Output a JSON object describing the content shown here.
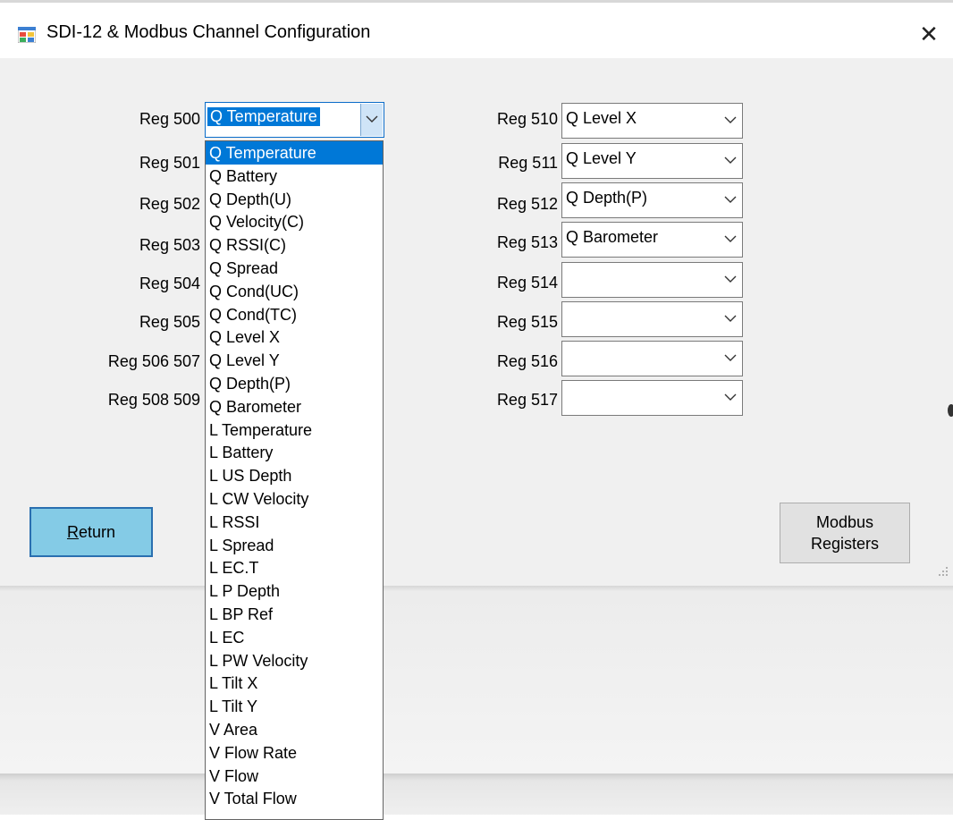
{
  "window": {
    "title": "SDI-12 & Modbus Channel Configuration",
    "close_glyph": "✕"
  },
  "left_registers": [
    {
      "label": "Reg 500",
      "value": "Q  Temperature"
    },
    {
      "label": "Reg 501"
    },
    {
      "label": "Reg 502"
    },
    {
      "label": "Reg 503"
    },
    {
      "label": "Reg 504"
    },
    {
      "label": "Reg 505"
    },
    {
      "label": "Reg 506 507"
    },
    {
      "label": "Reg 508 509"
    }
  ],
  "right_registers": [
    {
      "label": "Reg 510",
      "value": "Q  Level X"
    },
    {
      "label": "Reg 511",
      "value": "Q  Level Y"
    },
    {
      "label": "Reg 512",
      "value": "Q  Depth(P)"
    },
    {
      "label": "Reg 513",
      "value": "Q  Barometer"
    },
    {
      "label": "Reg 514",
      "value": ""
    },
    {
      "label": "Reg 515",
      "value": ""
    },
    {
      "label": "Reg 516",
      "value": ""
    },
    {
      "label": "Reg 517",
      "value": ""
    }
  ],
  "dropdown_options": [
    "Q  Temperature",
    "Q  Battery",
    "Q  Depth(U)",
    "Q  Velocity(C)",
    "Q  RSSI(C)",
    "Q  Spread",
    "Q  Cond(UC)",
    "Q  Cond(TC)",
    "Q  Level X",
    "Q  Level Y",
    "Q  Depth(P)",
    "Q  Barometer",
    "L  Temperature",
    "L  Battery",
    "L  US Depth",
    "L  CW Velocity",
    "L  RSSI",
    "L  Spread",
    "L  EC.T",
    "L  P Depth",
    "L  BP Ref",
    "L  EC",
    "L  PW Velocity",
    "L  Tilt X",
    "L  Tilt Y",
    "V  Area",
    "V  Flow Rate",
    "V  Flow",
    "V  Total Flow"
  ],
  "dropdown_selected_index": 0,
  "buttons": {
    "return_mnemonic": "R",
    "return_rest": "eturn",
    "modbus_line1": "Modbus",
    "modbus_line2": "Registers"
  }
}
